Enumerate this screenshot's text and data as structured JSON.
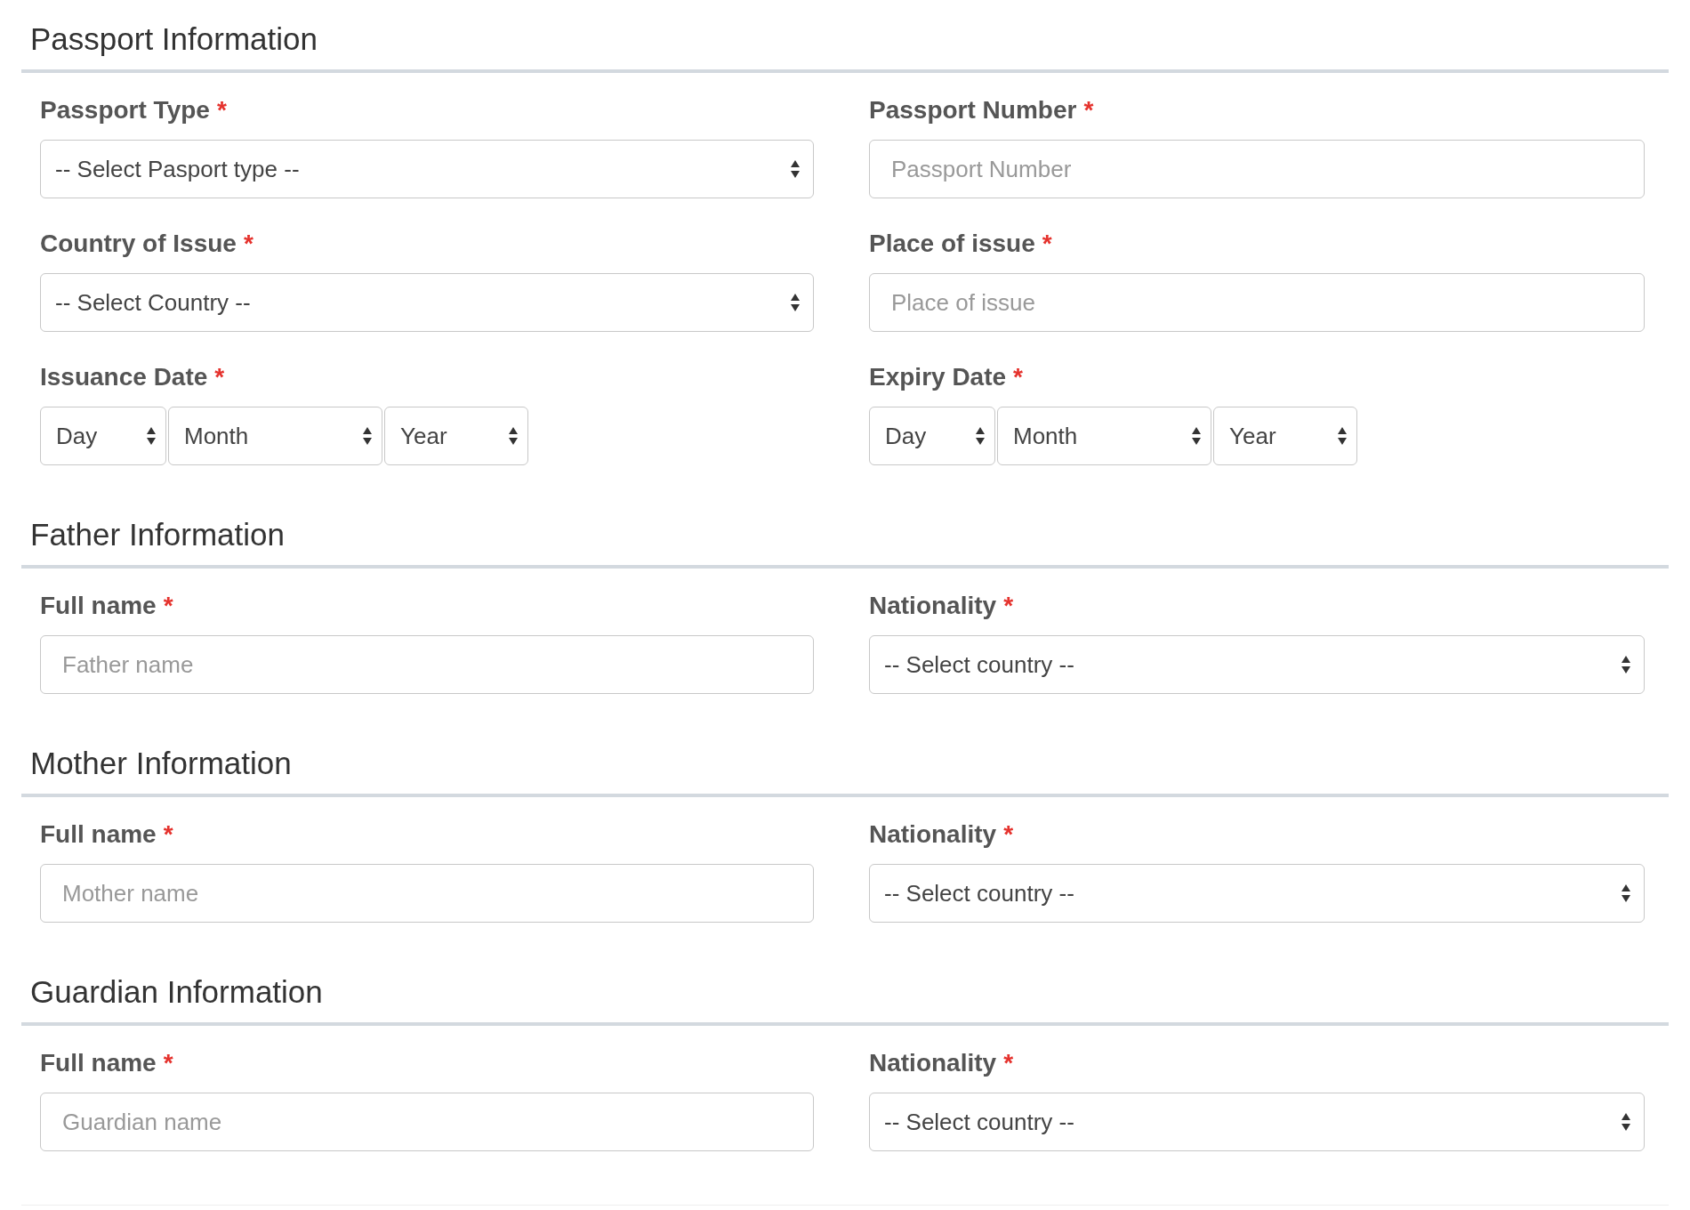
{
  "required_mark": "*",
  "sections": [
    {
      "title": "Passport Information",
      "rows": [
        [
          {
            "label": "Passport Type",
            "required": true,
            "kind": "select",
            "value": "-- Select Pasport type --"
          },
          {
            "label": "Passport Number",
            "required": true,
            "kind": "input",
            "placeholder": "Passport Number"
          }
        ],
        [
          {
            "label": "Country of Issue",
            "required": true,
            "kind": "select",
            "value": "-- Select Country --"
          },
          {
            "label": "Place of issue",
            "required": true,
            "kind": "input",
            "placeholder": "Place of issue"
          }
        ],
        [
          {
            "label": "Issuance Date",
            "required": true,
            "kind": "date",
            "parts": [
              "Day",
              "Month",
              "Year"
            ]
          },
          {
            "label": "Expiry Date",
            "required": true,
            "kind": "date",
            "parts": [
              "Day",
              "Month",
              "Year"
            ]
          }
        ]
      ]
    },
    {
      "title": "Father Information",
      "rows": [
        [
          {
            "label": "Full name",
            "required": true,
            "kind": "input",
            "placeholder": "Father name"
          },
          {
            "label": "Nationality",
            "required": true,
            "kind": "select",
            "value": "-- Select country --"
          }
        ]
      ]
    },
    {
      "title": "Mother Information",
      "rows": [
        [
          {
            "label": "Full name",
            "required": true,
            "kind": "input",
            "placeholder": "Mother name"
          },
          {
            "label": "Nationality",
            "required": true,
            "kind": "select",
            "value": "-- Select country --"
          }
        ]
      ]
    },
    {
      "title": "Guardian Information",
      "rows": [
        [
          {
            "label": "Full name",
            "required": true,
            "kind": "input",
            "placeholder": "Guardian name"
          },
          {
            "label": "Nationality",
            "required": true,
            "kind": "select",
            "value": "-- Select country --"
          }
        ]
      ]
    }
  ]
}
